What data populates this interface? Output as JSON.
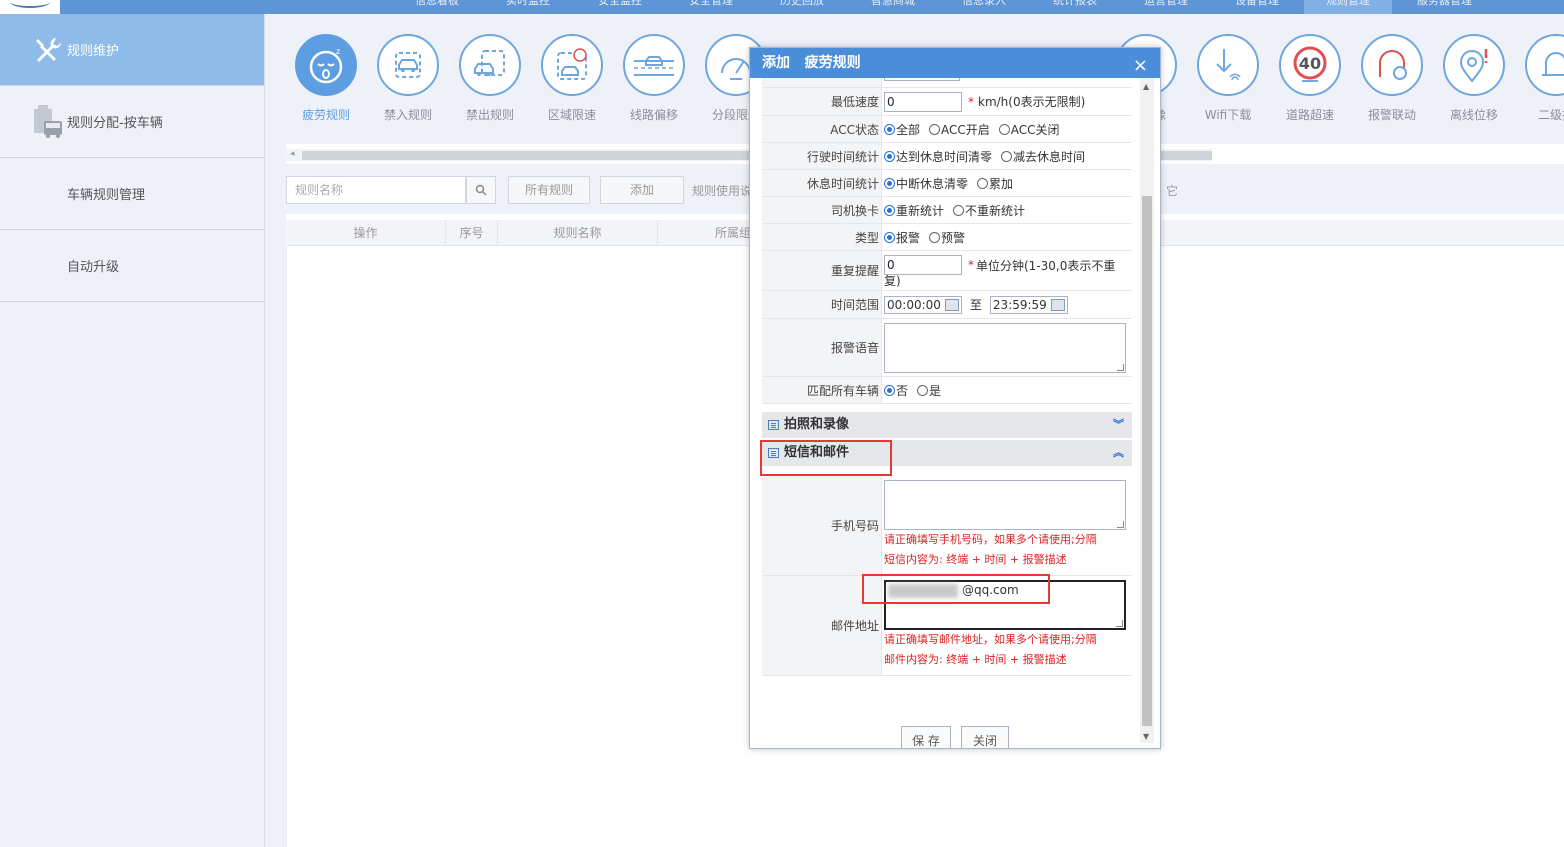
{
  "topnav": {
    "items": [
      "信息看板",
      "实时监控",
      "安全监控",
      "安全管理",
      "历史回放",
      "智慧商城",
      "信息录入",
      "统计报表",
      "运营管理",
      "设备管理",
      "规则管理",
      "服务器管理"
    ]
  },
  "sidebar": {
    "items": [
      {
        "label": "规则维护",
        "icon": "wrench-screwdriver-icon",
        "active": true
      },
      {
        "label": "规则分配-按车辆",
        "icon": "bus-document-icon",
        "active": false
      },
      {
        "label": "车辆规则管理",
        "icon": "",
        "active": false
      },
      {
        "label": "自动升级",
        "icon": "",
        "active": false
      }
    ]
  },
  "toolbar": {
    "tools": [
      {
        "label": "疲劳规则",
        "icon": "sleepy-face-icon",
        "active": true
      },
      {
        "label": "禁入规则",
        "icon": "car-enter-icon"
      },
      {
        "label": "禁出规则",
        "icon": "car-exit-icon"
      },
      {
        "label": "区域限速",
        "icon": "area-speed-icon"
      },
      {
        "label": "线路偏移",
        "icon": "route-offset-icon"
      },
      {
        "label": "分段限速",
        "icon": "speedometer-icon"
      },
      {
        "label": "像",
        "icon": "camera-icon"
      },
      {
        "label": "Wifi下载",
        "icon": "wifi-download-icon"
      },
      {
        "label": "道路超速",
        "icon": "speed-limit-40-icon"
      },
      {
        "label": "报警联动",
        "icon": "alarm-link-icon"
      },
      {
        "label": "离线位移",
        "icon": "location-alert-icon"
      },
      {
        "label": "二级报",
        "icon": "bell-icon"
      }
    ],
    "speed_sign": "40"
  },
  "filter": {
    "search_placeholder": "规则名称",
    "all_rules": "所有规则",
    "add": "添加",
    "usage_text": "规则使用说",
    "other_text": "它"
  },
  "table": {
    "headers": [
      "操作",
      "序号",
      "规则名称",
      "所属组"
    ]
  },
  "dialog": {
    "title": "添加   疲劳规则",
    "close": "×",
    "rows": {
      "min_speed": {
        "label": "最低速度",
        "value": "0",
        "hint": "km/h(0表示无限制)",
        "req": "*"
      },
      "acc": {
        "label": "ACC状态",
        "options": [
          "全部",
          "ACC开启",
          "ACC关闭"
        ]
      },
      "drive_stat": {
        "label": "行驶时间统计",
        "options": [
          "达到休息时间清零",
          "减去休息时间"
        ]
      },
      "rest_stat": {
        "label": "休息时间统计",
        "options": [
          "中断休息清零",
          "累加"
        ]
      },
      "card": {
        "label": "司机换卡",
        "options": [
          "重新统计",
          "不重新统计"
        ]
      },
      "type": {
        "label": "类型",
        "options": [
          "报警",
          "预警"
        ]
      },
      "repeat": {
        "label": "重复提醒",
        "value": "0",
        "req": "*",
        "hint": "单位分钟(1-30,0表示不重",
        "hint2": "复)"
      },
      "time_range": {
        "label": "时间范围",
        "start": "00:00:00",
        "to": "至",
        "end": "23:59:59"
      },
      "voice": {
        "label": "报警语音"
      },
      "match_all": {
        "label": "匹配所有车辆",
        "options": [
          "否",
          "是"
        ]
      }
    },
    "sections": {
      "photo": "拍照和录像",
      "sms": "短信和邮件"
    },
    "phone": {
      "label": "手机号码",
      "hint1": "请正确填写手机号码，如果多个请使用;分隔",
      "hint2": "短信内容为: 终端 + 时间 + 报警描述"
    },
    "email": {
      "label": "邮件地址",
      "value": "@qq.com",
      "hint1": "请正确填写邮件地址，如果多个请使用;分隔",
      "hint2": "邮件内容为: 终端 + 时间 + 报警描述"
    },
    "buttons": {
      "save": "保 存",
      "close": "关闭"
    }
  },
  "colors": {
    "accent": "#4a8ed9",
    "sidebar_active": "#8fbbe9",
    "highlight_red": "#e53935"
  }
}
